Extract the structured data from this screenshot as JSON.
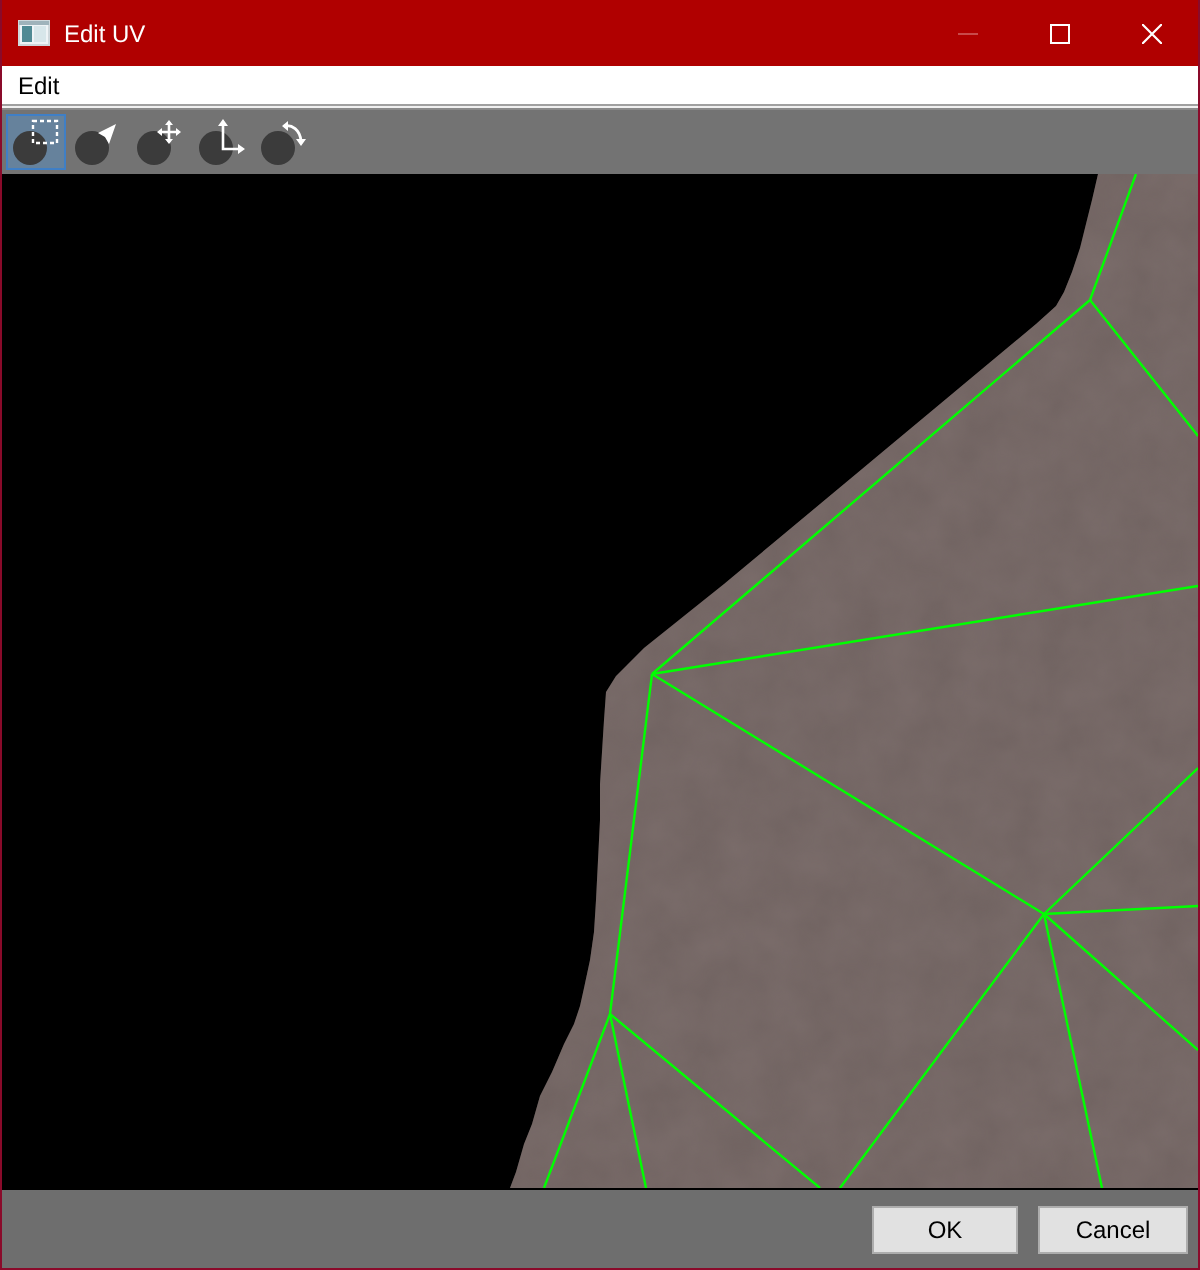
{
  "window": {
    "title": "Edit UV",
    "controls": [
      {
        "kind": "minimize",
        "disabled": true
      },
      {
        "kind": "maximize",
        "disabled": false
      },
      {
        "kind": "close",
        "disabled": false
      }
    ]
  },
  "menu": [
    {
      "label": "Edit"
    }
  ],
  "toolbar": [
    {
      "kind": "rect-select",
      "selected": true
    },
    {
      "kind": "pointer",
      "selected": false
    },
    {
      "kind": "move",
      "selected": false
    },
    {
      "kind": "axes",
      "selected": false
    },
    {
      "kind": "rotate",
      "selected": false
    }
  ],
  "buttons": [
    {
      "label": "OK"
    },
    {
      "label": "Cancel"
    }
  ]
}
